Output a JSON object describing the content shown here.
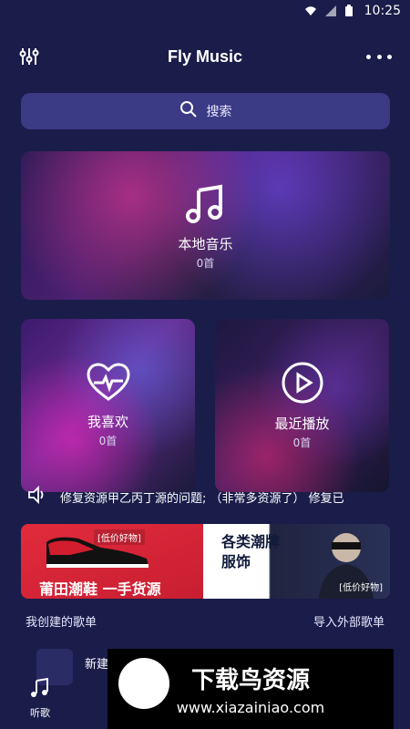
{
  "status": {
    "time": "10:25"
  },
  "header": {
    "title": "Fly Music"
  },
  "search": {
    "placeholder": "搜索"
  },
  "cards": {
    "local": {
      "label": "本地音乐",
      "count": "0首"
    },
    "favorites": {
      "label": "我喜欢",
      "count": "0首"
    },
    "recent": {
      "label": "最近播放",
      "count": "0首"
    }
  },
  "notice": {
    "text": "修复资源甲乙丙丁源的问题; （非常多资源了） 修复已"
  },
  "banner": {
    "left_tag": "[低价好物]",
    "left_big": "莆田潮鞋 一手货源",
    "right_title1": "各类潮牌",
    "right_title2": "服饰",
    "right_tag": "[低价好物]"
  },
  "playlists": {
    "my_created": "我创建的歌单",
    "import": "导入外部歌单",
    "new": "新建"
  },
  "bottom_nav": {
    "listen_label": "听歌"
  },
  "watermark": {
    "title": "下载鸟资源",
    "url": "www.xiazainiao.com"
  },
  "colors": {
    "bg": "#1a1c4a",
    "search_bg": "#3a3a85",
    "banner_red": "#e22b3d"
  }
}
